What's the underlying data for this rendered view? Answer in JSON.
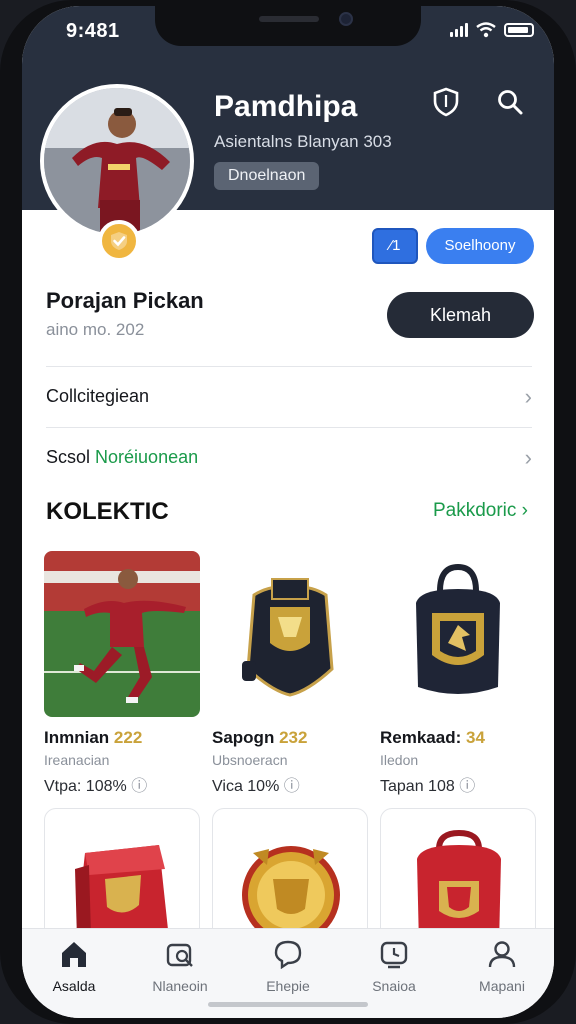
{
  "status_bar": {
    "time": "9:481"
  },
  "profile": {
    "name": "Pamdhipa",
    "subtitle": "Asientalns Blanyan 303",
    "tag": "Dnoelnaon"
  },
  "actions": {
    "mini_button": "⁄1",
    "pill_button": "Soelhoony"
  },
  "user": {
    "name": "Porajan Pickan",
    "date": "aino mo. 202",
    "button": "Klemah"
  },
  "rows": [
    {
      "label": "Collcitegiean",
      "label_accent": ""
    },
    {
      "label": "Scsol ",
      "label_accent": "Noréiuonean"
    }
  ],
  "collection": {
    "title": "KOLEKTIC",
    "link": "Pakkdoric ›"
  },
  "cards": [
    {
      "title": "Inmnian",
      "price": "222",
      "sub": "Ireanacian",
      "meta": "Vtpa: 108%"
    },
    {
      "title": "Sapogn",
      "price": "232",
      "sub": "Ubsnoeracn",
      "meta": "Vica 10%"
    },
    {
      "title": "Remkaad:",
      "price": "34",
      "sub": "Iledon",
      "meta": "Tapan 108"
    }
  ],
  "tabs": [
    {
      "label": "Asalda",
      "icon": "home-icon"
    },
    {
      "label": "Nlaneoin",
      "icon": "store-icon"
    },
    {
      "label": "Ehepie",
      "icon": "chat-icon"
    },
    {
      "label": "Snaioa",
      "icon": "clock-icon"
    },
    {
      "label": "Mapani",
      "icon": "user-icon"
    }
  ],
  "colors": {
    "header": "#28303f",
    "accent_blue": "#3a7ff0",
    "accent_green": "#1a9a4a",
    "gold": "#c9a23a",
    "dark_button": "#252b37"
  }
}
